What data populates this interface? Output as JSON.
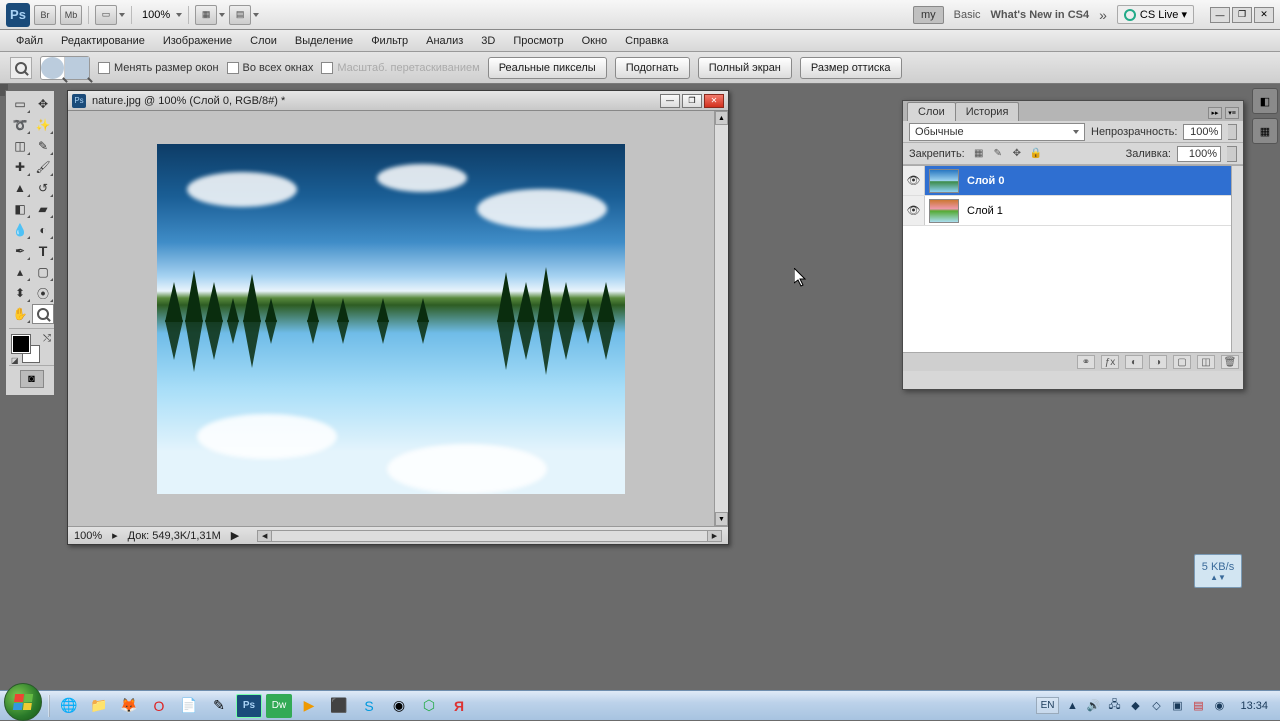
{
  "appbar": {
    "zoom": "100%",
    "my": "my",
    "basic": "Basic",
    "whatsnew": "What's New in CS4",
    "cslive": "CS Live ▾"
  },
  "menu": [
    "Файл",
    "Редактирование",
    "Изображение",
    "Слои",
    "Выделение",
    "Фильтр",
    "Анализ",
    "3D",
    "Просмотр",
    "Окно",
    "Справка"
  ],
  "options": {
    "resize_windows": "Менять размер окон",
    "all_windows": "Во всех окнах",
    "scrub": "Масштаб. перетаскиванием",
    "actual_px": "Реальные пикселы",
    "fit": "Подогнать",
    "full": "Полный экран",
    "print": "Размер оттиска"
  },
  "doc": {
    "title": "nature.jpg @ 100% (Слой 0, RGB/8#) *",
    "zoom": "100%",
    "status": "Док: 549,3K/1,31M"
  },
  "layers_panel": {
    "tab_layers": "Слои",
    "tab_history": "История",
    "blend": "Обычные",
    "opacity_label": "Непрозрачность:",
    "opacity_val": "100%",
    "lock_label": "Закрепить:",
    "fill_label": "Заливка:",
    "fill_val": "100%",
    "layers": [
      {
        "name": "Слой 0",
        "sel": true
      },
      {
        "name": "Слой 1",
        "sel": false
      }
    ]
  },
  "widget": {
    "speed": "5 KB/s"
  },
  "taskbar": {
    "lang": "EN",
    "time": "13:34"
  }
}
